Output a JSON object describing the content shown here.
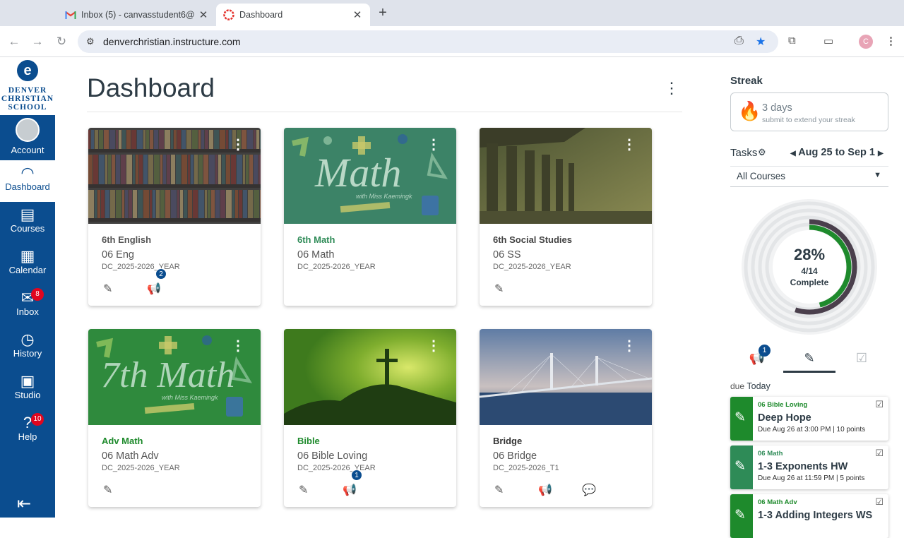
{
  "browser": {
    "tabs": [
      {
        "title": "Inbox (5) - canvasstudent6@",
        "icon": "gmail-icon"
      },
      {
        "title": "Dashboard",
        "icon": "canvas-icon"
      }
    ],
    "url": "denverchristian.instructure.com",
    "profile_initial": "C"
  },
  "nav": {
    "logo_text": "DENVER CHRISTIAN SCHOOL",
    "items": [
      {
        "label": "Account",
        "icon": "account-avatar"
      },
      {
        "label": "Dashboard",
        "icon": "dashboard-icon",
        "active": true
      },
      {
        "label": "Courses",
        "icon": "courses-icon"
      },
      {
        "label": "Calendar",
        "icon": "calendar-icon"
      },
      {
        "label": "Inbox",
        "icon": "inbox-icon",
        "badge": "8"
      },
      {
        "label": "History",
        "icon": "history-icon"
      },
      {
        "label": "Studio",
        "icon": "studio-icon"
      },
      {
        "label": "Help",
        "icon": "help-icon",
        "badge": "10"
      }
    ]
  },
  "page": {
    "title": "Dashboard"
  },
  "cards": [
    {
      "name": "6th English",
      "code": "06 Eng",
      "term": "DC_2025-2026_YEAR",
      "name_color": "#555555",
      "announce_badge": "2"
    },
    {
      "name": "6th Math",
      "code": "06 Math",
      "term": "DC_2025-2026_YEAR",
      "name_color": "#2e8b57",
      "hero_text": "Math",
      "hero_sub": "with Miss Kaemingk"
    },
    {
      "name": "6th Social Studies",
      "code": "06 SS",
      "term": "DC_2025-2026_YEAR",
      "name_color": "#444444"
    },
    {
      "name": "Adv Math",
      "code": "06 Math Adv",
      "term": "DC_2025-2026_YEAR",
      "name_color": "#1e8a2c",
      "hero_text": "7th Math",
      "hero_sub": "with Miss Kaemingk"
    },
    {
      "name": "Bible",
      "code": "06 Bible Loving",
      "term": "DC_2025-2026_YEAR",
      "name_color": "#1e8a2c",
      "announce_badge": "1"
    },
    {
      "name": "Bridge",
      "code": "06 Bridge",
      "term": "DC_2025-2026_T1",
      "name_color": "#333333"
    }
  ],
  "sidebar": {
    "streak_heading": "Streak",
    "streak_days": "3 days",
    "streak_sub": "submit to extend your streak",
    "tasks_heading": "Tasks",
    "date_range": "Aug 25 to Sep 1",
    "course_filter": "All Courses",
    "progress_percent_label": "28%",
    "progress_count": "4/14",
    "progress_label": "Complete",
    "progress_value": 0.2857,
    "tab_badge": "1",
    "due_prefix": "due",
    "due_day": "Today",
    "tasks": [
      {
        "course": "06 Bible Loving",
        "title": "Deep Hope",
        "due": "Due Aug 26 at 3:00 PM  |  10 points",
        "color": "#1e8a2c"
      },
      {
        "course": "06 Math",
        "title": "1-3 Exponents HW",
        "due": "Due Aug 26 at 11:59 PM  |  5 points",
        "color": "#2e8b57"
      },
      {
        "course": "06 Math Adv",
        "title": "1-3 Adding Integers WS",
        "due": "",
        "color": "#1e8a2c"
      }
    ]
  }
}
